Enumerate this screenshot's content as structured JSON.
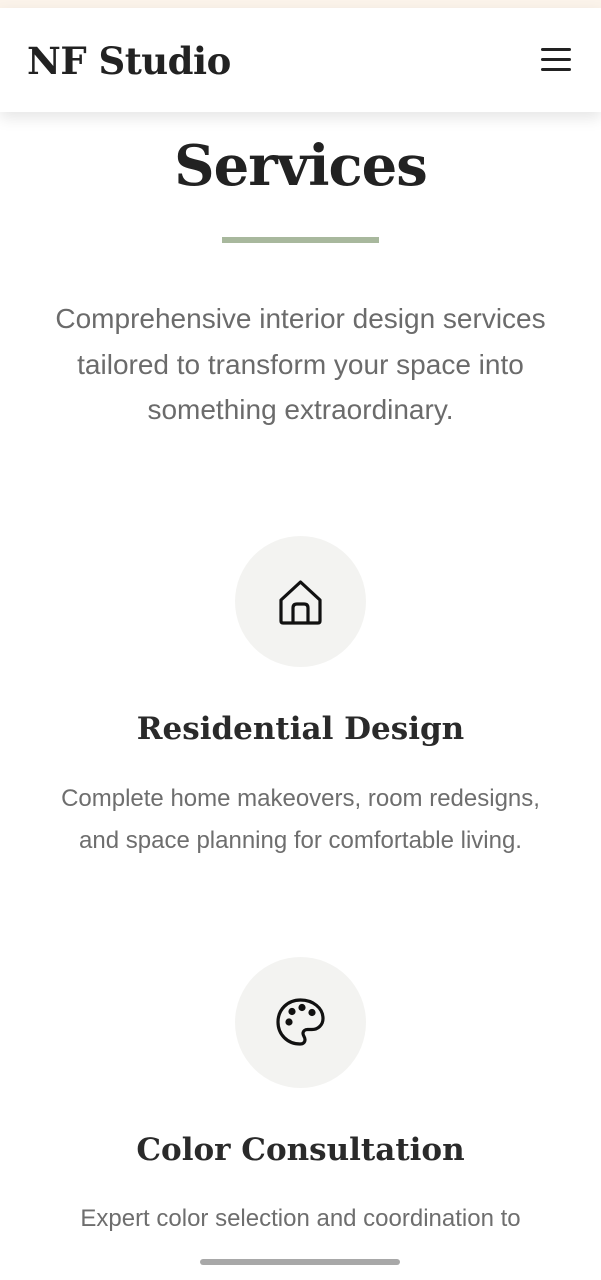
{
  "header": {
    "brand": "NF Studio",
    "menu_icon": "hamburger-menu-icon"
  },
  "services_section": {
    "title": "Services",
    "intro": "Comprehensive interior design services tailored to transform your space into something extraordinary.",
    "items": [
      {
        "icon": "home-icon",
        "title": "Residential Design",
        "description": "Complete home makeovers, room redesigns, and space planning for comfortable living."
      },
      {
        "icon": "palette-icon",
        "title": "Color Consultation",
        "description": "Expert color selection and coordination to"
      }
    ]
  },
  "colors": {
    "accent_rule": "#a8b89d",
    "icon_circle": "#f3f3f1",
    "heading": "#222222",
    "body_text": "#6b6b6b",
    "top_strip": "#fbf3ea"
  }
}
